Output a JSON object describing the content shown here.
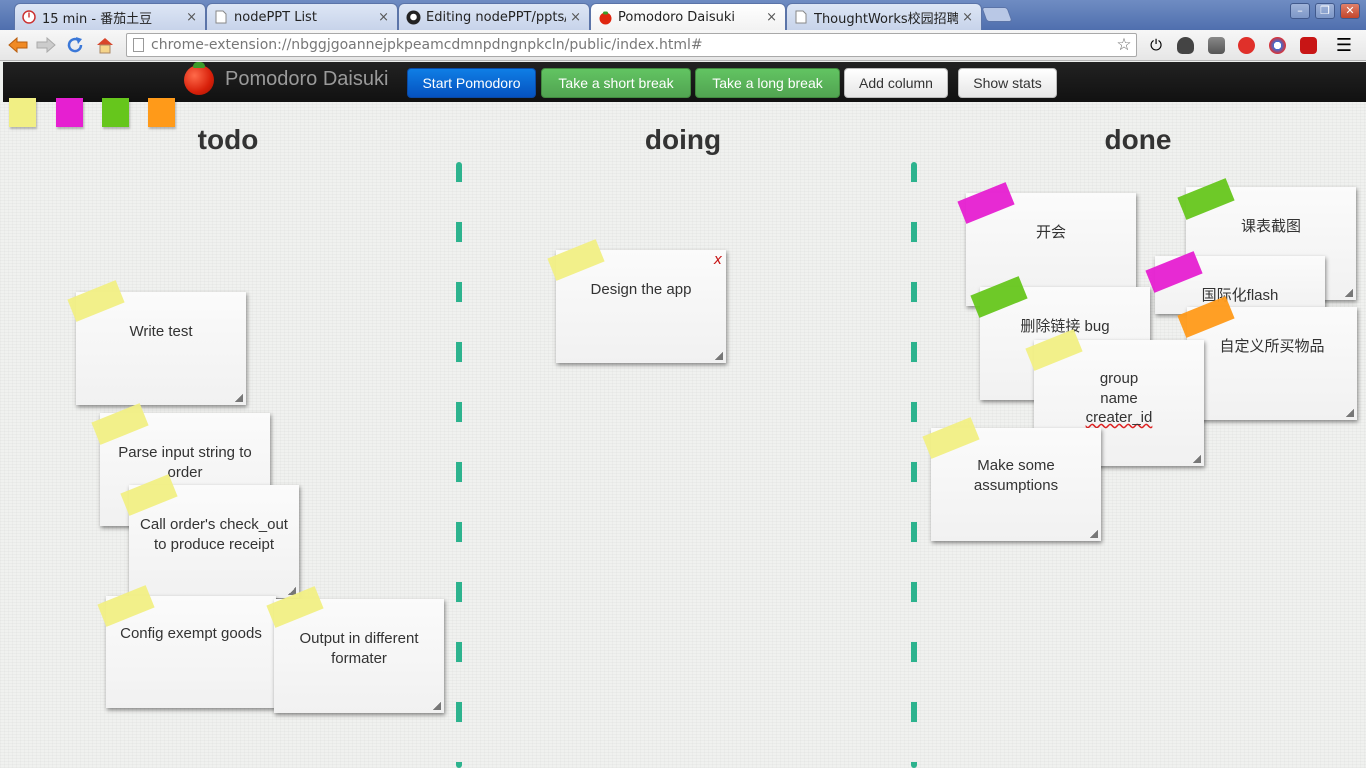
{
  "browser": {
    "tabs": [
      {
        "title": "15 min - 番茄土豆",
        "icon": "tomato-timer-icon",
        "close": "×"
      },
      {
        "title": "nodePPT List",
        "icon": "page-icon",
        "close": "×"
      },
      {
        "title": "Editing nodePPT/ppts/d",
        "icon": "github-icon",
        "close": "×"
      },
      {
        "title": "Pomodoro Daisuki",
        "icon": "tomato-icon",
        "close": "×"
      },
      {
        "title": "ThoughtWorks校园招聘",
        "icon": "page-icon",
        "close": "×"
      }
    ],
    "url": "chrome-extension://nbggjgoannejpkpeamcdmnpdngnpkcln/public/index.html#"
  },
  "app": {
    "brand": "Pomodoro Daisuki",
    "buttons": {
      "start": "Start Pomodoro",
      "short_break": "Take a short break",
      "long_break": "Take a long break",
      "add_column": "Add column",
      "show_stats": "Show stats"
    },
    "swatch_colors": [
      "#f1ef84",
      "#e61fd1",
      "#66c61c",
      "#ff9a19"
    ],
    "columns": {
      "todo": {
        "title": "todo",
        "cards": {
          "write_test": "Write test",
          "parse_input": "Parse input string to order",
          "call_order": "Call order's check_out to produce receipt",
          "config_exempt": "Config exempt goods",
          "output_formater": "Output in different formater"
        }
      },
      "doing": {
        "title": "doing",
        "cards": {
          "design_app": "Design the app",
          "design_app_close": "x"
        }
      },
      "done": {
        "title": "done",
        "cards": {
          "meeting": "开会",
          "schedule_shot": "课表截图",
          "i18n": "国际化flash",
          "delete_link_bug": "删除链接 bug",
          "custom_items": "自定义所买物品",
          "group_line1": "group",
          "group_line2": "name",
          "group_line3": "creater_id",
          "assumptions": "Make some assumptions"
        }
      }
    }
  }
}
